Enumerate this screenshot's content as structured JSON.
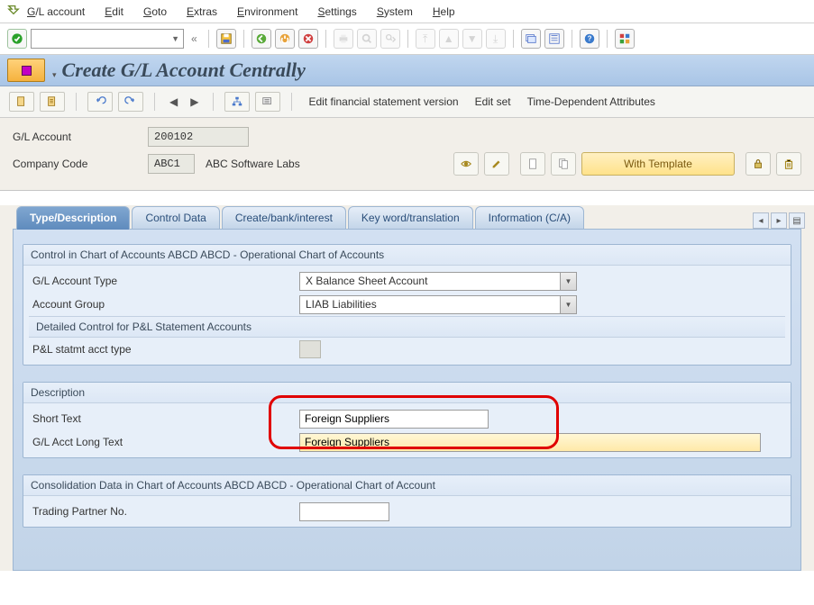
{
  "menu": {
    "items": [
      "G/L account",
      "Edit",
      "Goto",
      "Extras",
      "Environment",
      "Settings",
      "System",
      "Help"
    ]
  },
  "title": "Create G/L Account Centrally",
  "app_toolbar": {
    "edit_fsv": "Edit financial statement version",
    "edit_set": "Edit set",
    "time_dep": "Time-Dependent Attributes"
  },
  "header": {
    "gl_account_label": "G/L Account",
    "gl_account_value": "200102",
    "company_code_label": "Company Code",
    "company_code_value": "ABC1",
    "company_code_text": "ABC Software Labs",
    "with_template": "With Template"
  },
  "tabs": [
    "Type/Description",
    "Control Data",
    "Create/bank/interest",
    "Key word/translation",
    "Information (C/A)"
  ],
  "group1": {
    "title": "Control in Chart of Accounts ABCD ABCD - Operational Chart of Accounts",
    "acct_type_label": "G/L Account Type",
    "acct_type_value": "X Balance Sheet Account",
    "acct_group_label": "Account Group",
    "acct_group_value": "LIAB Liabilities",
    "sub_title": "Detailed Control for P&L Statement Accounts",
    "pl_label": "P&L statmt acct type"
  },
  "group2": {
    "title": "Description",
    "short_label": "Short Text",
    "short_value": "Foreign Suppliers",
    "long_label": "G/L Acct Long Text",
    "long_value": "Foreign Suppliers"
  },
  "group3": {
    "title": "Consolidation Data in Chart of Accounts ABCD ABCD - Operational Chart of Account",
    "tp_label": "Trading Partner No."
  }
}
